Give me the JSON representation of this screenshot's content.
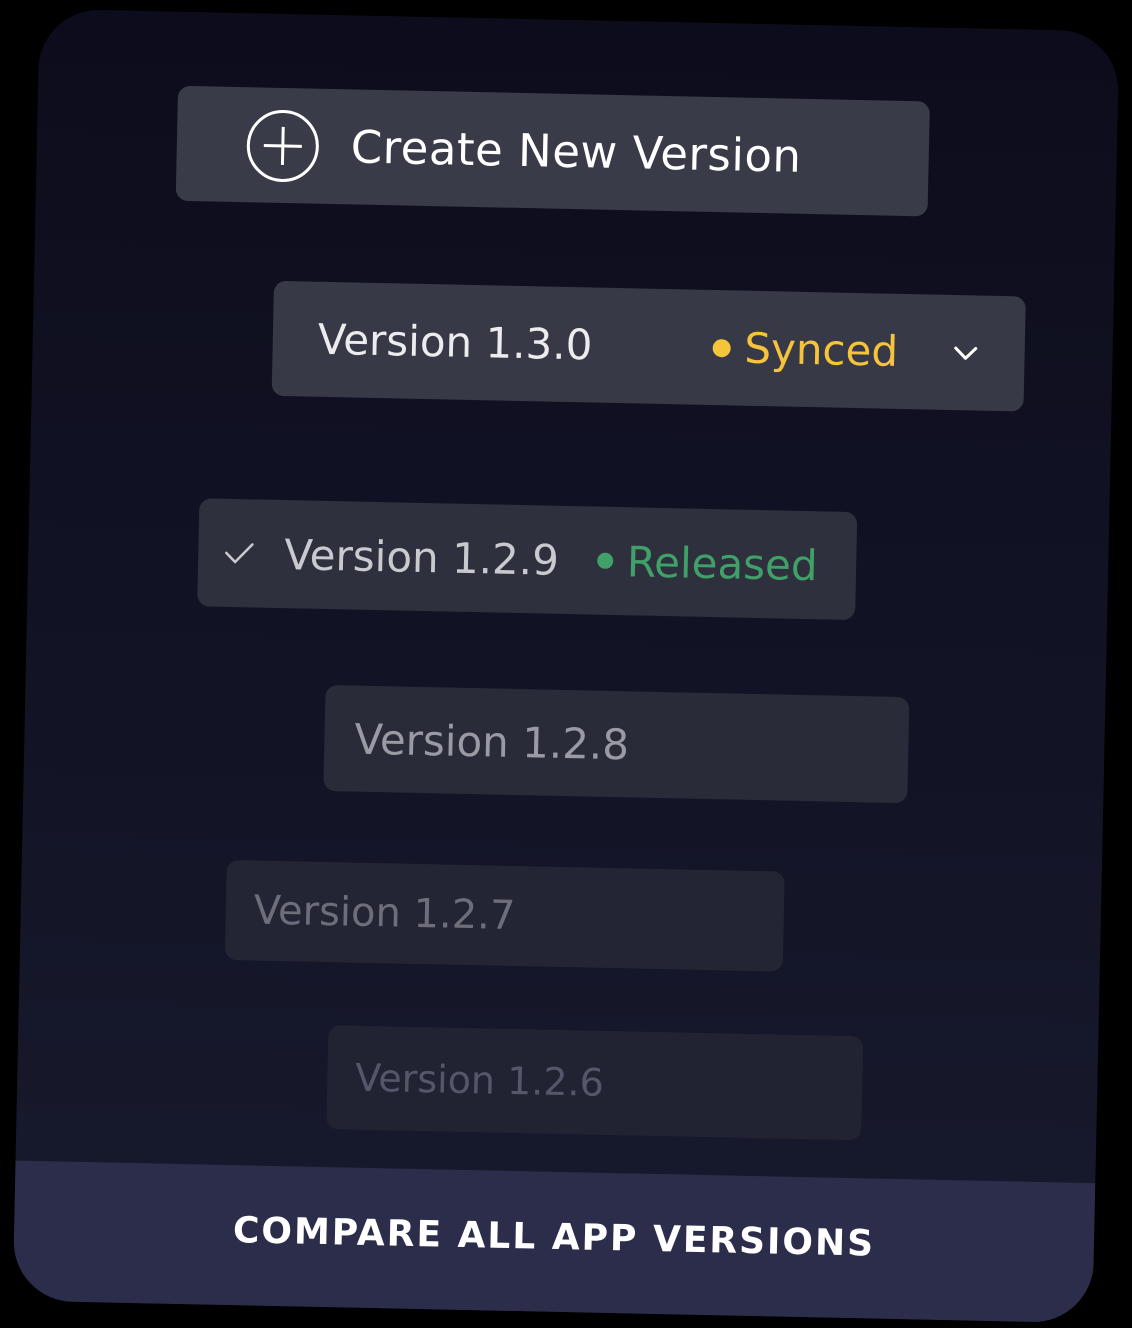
{
  "create_button": {
    "label": "Create New Version",
    "icon": "plus-circle-icon"
  },
  "versions": [
    {
      "label": "Version 1.3.0",
      "status": "Synced",
      "status_color": "#f5c43a",
      "expanded_control": "chevron-down-icon"
    },
    {
      "label": "Version 1.2.9",
      "status": "Released",
      "status_color": "#3fa068",
      "selected": true,
      "selected_icon": "check-icon"
    },
    {
      "label": "Version 1.2.8"
    },
    {
      "label": "Version 1.2.7"
    },
    {
      "label": "Version 1.2.6"
    }
  ],
  "footer": {
    "label": "COMPARE ALL APP VERSIONS"
  },
  "colors": {
    "card_background": "#0d0c1c",
    "footer_background": "#2c2d4b",
    "synced": "#f5c43a",
    "released": "#3fa068"
  }
}
